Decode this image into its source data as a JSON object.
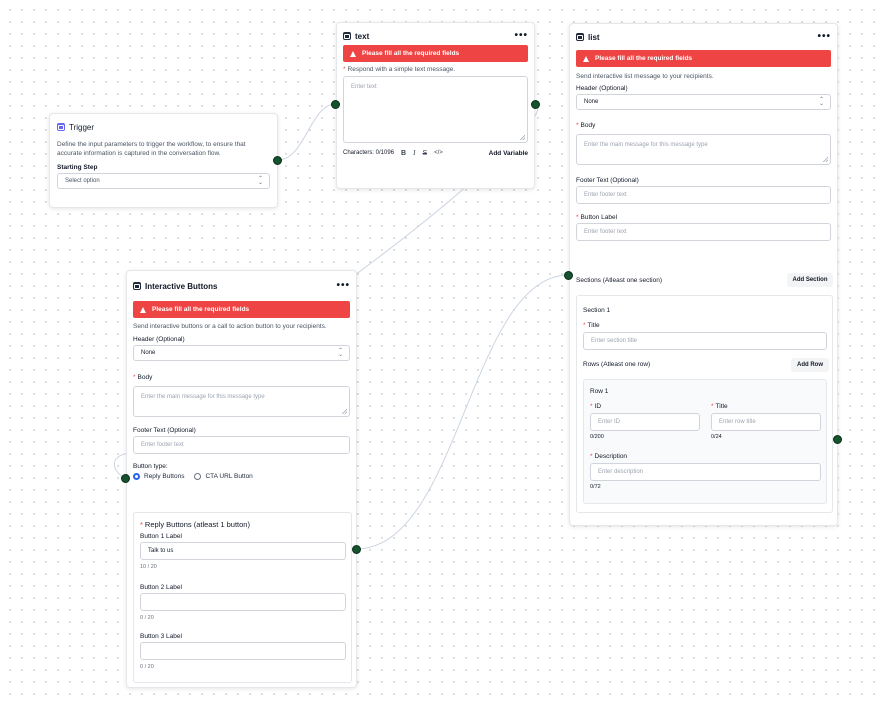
{
  "trigger": {
    "title": "Trigger",
    "description": "Define the input parameters to trigger the workflow, to ensure that accurate information is captured in the conversation flow.",
    "starting_step_label": "Starting Step",
    "starting_step_placeholder": "Select option"
  },
  "text_node": {
    "title": "text",
    "alert": "Please fill all the required fields",
    "prompt": "Respond with a simple text message.",
    "placeholder": "Enter text",
    "char_count": "Characters: 0/1096",
    "tools": {
      "bold": "B",
      "italic": "I",
      "strike": "S",
      "code": "</>"
    },
    "add_variable": "Add Variable"
  },
  "list_node": {
    "title": "list",
    "alert": "Please fill all the required fields",
    "description": "Send interactive list message to your recipients.",
    "header_label": "Header (Optional)",
    "header_value": "None",
    "body_label": "Body",
    "body_placeholder": "Enter the main message for this message type",
    "footer_label": "Footer Text (Optional)",
    "footer_placeholder": "Enter footer text",
    "button_label_label": "Button Label",
    "button_label_placeholder": "Enter footer text",
    "sections_label": "Sections (Atleast one section)",
    "add_section": "Add Section",
    "section": {
      "title": "Section 1",
      "title_label": "Title",
      "title_placeholder": "Enter section title",
      "rows_label": "Rows (Atleast one row)",
      "add_row": "Add Row",
      "row": {
        "title": "Row 1",
        "id_label": "ID",
        "id_placeholder": "Enter ID",
        "id_count": "0/200",
        "row_title_label": "Title",
        "row_title_placeholder": "Enter row title",
        "row_title_count": "0/24",
        "description_label": "Description",
        "description_placeholder": "Enter description",
        "description_count": "0/72"
      }
    }
  },
  "buttons_node": {
    "title": "Interactive Buttons",
    "alert": "Please fill all the required fields",
    "description": "Send interactive buttons or a call to action button to your recipients.",
    "header_label": "Header (Optional)",
    "header_value": "None",
    "body_label": "Body",
    "body_placeholder": "Enter the main message for this message type",
    "footer_label": "Footer Text (Optional)",
    "footer_placeholder": "Enter footer text",
    "button_type_label": "Button type:",
    "option_reply": "Reply Buttons",
    "option_cta": "CTA URL Button",
    "reply_heading": "Reply Buttons (atleast 1 button)",
    "button1_label": "Button 1 Label",
    "button1_value": "Talk to us",
    "button1_count": "10 / 20",
    "button2_label": "Button 2 Label",
    "button2_value": "",
    "button2_count": "0 / 20",
    "button3_label": "Button 3 Label",
    "button3_value": "",
    "button3_count": "0 / 20"
  },
  "more_glyph": "•••",
  "chevron_glyph": "⌃⌄",
  "colors": {
    "alert": "#ef4444",
    "handle": "#14532d",
    "radio_selected": "#2563eb",
    "edge": "#cbd5e1"
  }
}
